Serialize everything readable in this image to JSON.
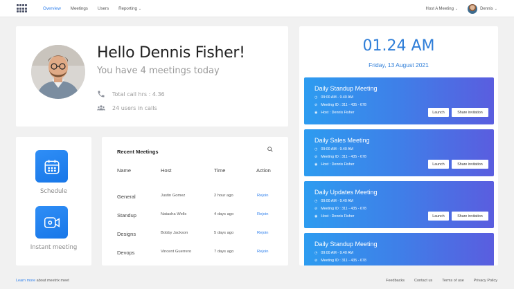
{
  "nav": {
    "items": [
      {
        "label": "Overview",
        "active": true
      },
      {
        "label": "Meetings",
        "active": false
      },
      {
        "label": "Users",
        "active": false
      },
      {
        "label": "Reporting",
        "active": false
      }
    ],
    "host_meeting_label": "Host A Meeting",
    "user_name": "Dennis"
  },
  "greeting": {
    "title": "Hello Dennis Fisher!",
    "subtitle": "You have 4 meetings today",
    "call_hours": "Total call hrs : 4.36",
    "users_in_calls": "24 users in calls"
  },
  "quick_actions": [
    {
      "label": "Schedule",
      "icon": "calendar-icon"
    },
    {
      "label": "Instant meeting",
      "icon": "video-camera-icon"
    }
  ],
  "recent_meetings": {
    "title": "Recent Meetings",
    "columns": [
      "Name",
      "Host",
      "Time",
      "Action"
    ],
    "rows": [
      {
        "name": "General",
        "host": "Justin Gomez",
        "time": "2 hour ago",
        "action": "Rejoin"
      },
      {
        "name": "Standup",
        "host": "Natasha Wells",
        "time": "4 days ago",
        "action": "Rejoin"
      },
      {
        "name": "Designs",
        "host": "Bobby Jackson",
        "time": "5 days ago",
        "action": "Rejoin"
      },
      {
        "name": "Devops",
        "host": "Vincent Guerrero",
        "time": "7 days ago",
        "action": "Rejoin"
      }
    ]
  },
  "clock": {
    "time": "01.24 AM",
    "date": "Friday, 13 August 2021"
  },
  "upcoming_meetings": [
    {
      "title": "Daily Standup Meeting",
      "time": "09:00 AM - 9.40 AM",
      "meeting_id": "Meeting ID : 311 - 435 - 678",
      "host": "Host : Dennis Fisher",
      "launch": "Launch",
      "share": "Share invitation"
    },
    {
      "title": "Daily Sales Meeting",
      "time": "09:00 AM - 9.40 AM",
      "meeting_id": "Meeting ID : 311 - 435 - 678",
      "host": "Host : Dennis Fisher",
      "launch": "Launch",
      "share": "Share invitation"
    },
    {
      "title": "Daily Updates Meeting",
      "time": "09:00 AM - 9.40 AM",
      "meeting_id": "Meeting ID : 311 - 435 - 678",
      "host": "Host : Dennis Fisher",
      "launch": "Launch",
      "share": "Share invitation"
    },
    {
      "title": "Daily Standup Meeting",
      "time": "09:00 AM - 9.40 AM",
      "meeting_id": "Meeting ID : 311 - 435 - 678",
      "host": "",
      "launch": "",
      "share": ""
    }
  ],
  "footer": {
    "learn_more": "Learn more",
    "learn_more_suffix": "about meetrix meet",
    "links": [
      "Feedbacks",
      "Contact us",
      "Terms of use",
      "Privacy Policy"
    ]
  },
  "colors": {
    "accent": "#2f80ed",
    "card_gradient_start": "#2d9cf0",
    "card_gradient_end": "#5a5ddf"
  }
}
